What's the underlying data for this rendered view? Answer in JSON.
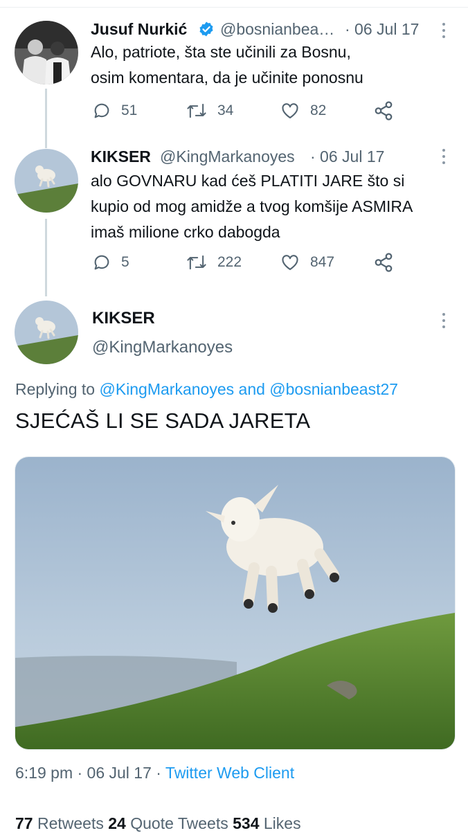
{
  "tweet1": {
    "name": "Jusuf Nurkić",
    "handle": "@bosnianbea…",
    "date": "· 06 Jul 17",
    "text_line1": "Alo, patriote, šta ste učinili za Bosnu,",
    "text_line2": "osim komentara, da je učinite ponosnu",
    "replies": "51",
    "retweets": "34",
    "likes": "82"
  },
  "tweet2": {
    "name": "KIKSER",
    "handle": "@KingMarkanoyes",
    "date": "· 06 Jul 17",
    "text_line1": "alo GOVNARU kad ćeš PLATITI JARE što si",
    "text_line2": "kupio od mog amidže a tvog komšije ASMIRA",
    "text_line3": "imaš milione crko dabogda",
    "replies": "5",
    "retweets": "222",
    "likes": "847"
  },
  "main": {
    "name": "KIKSER",
    "handle": "@KingMarkanoyes",
    "replying_prefix": "Replying to ",
    "replying_user1": "@KingMarkanoyes",
    "replying_and": " and ",
    "replying_user2": "@bosnianbeast27",
    "text": "SJEĆAŠ LI SE SADA JARETA",
    "time": "6:19 pm · 06 Jul 17 · ",
    "source": "Twitter Web Client",
    "retweets_count": "77",
    "retweets_label": " Retweets  ",
    "quotes_count": "24",
    "quotes_label": " Quote Tweets  ",
    "likes_count": "534",
    "likes_label": " Likes"
  },
  "colors": {
    "link": "#1d9bf0",
    "muted": "#536471",
    "verified": "#1d9bf0"
  }
}
